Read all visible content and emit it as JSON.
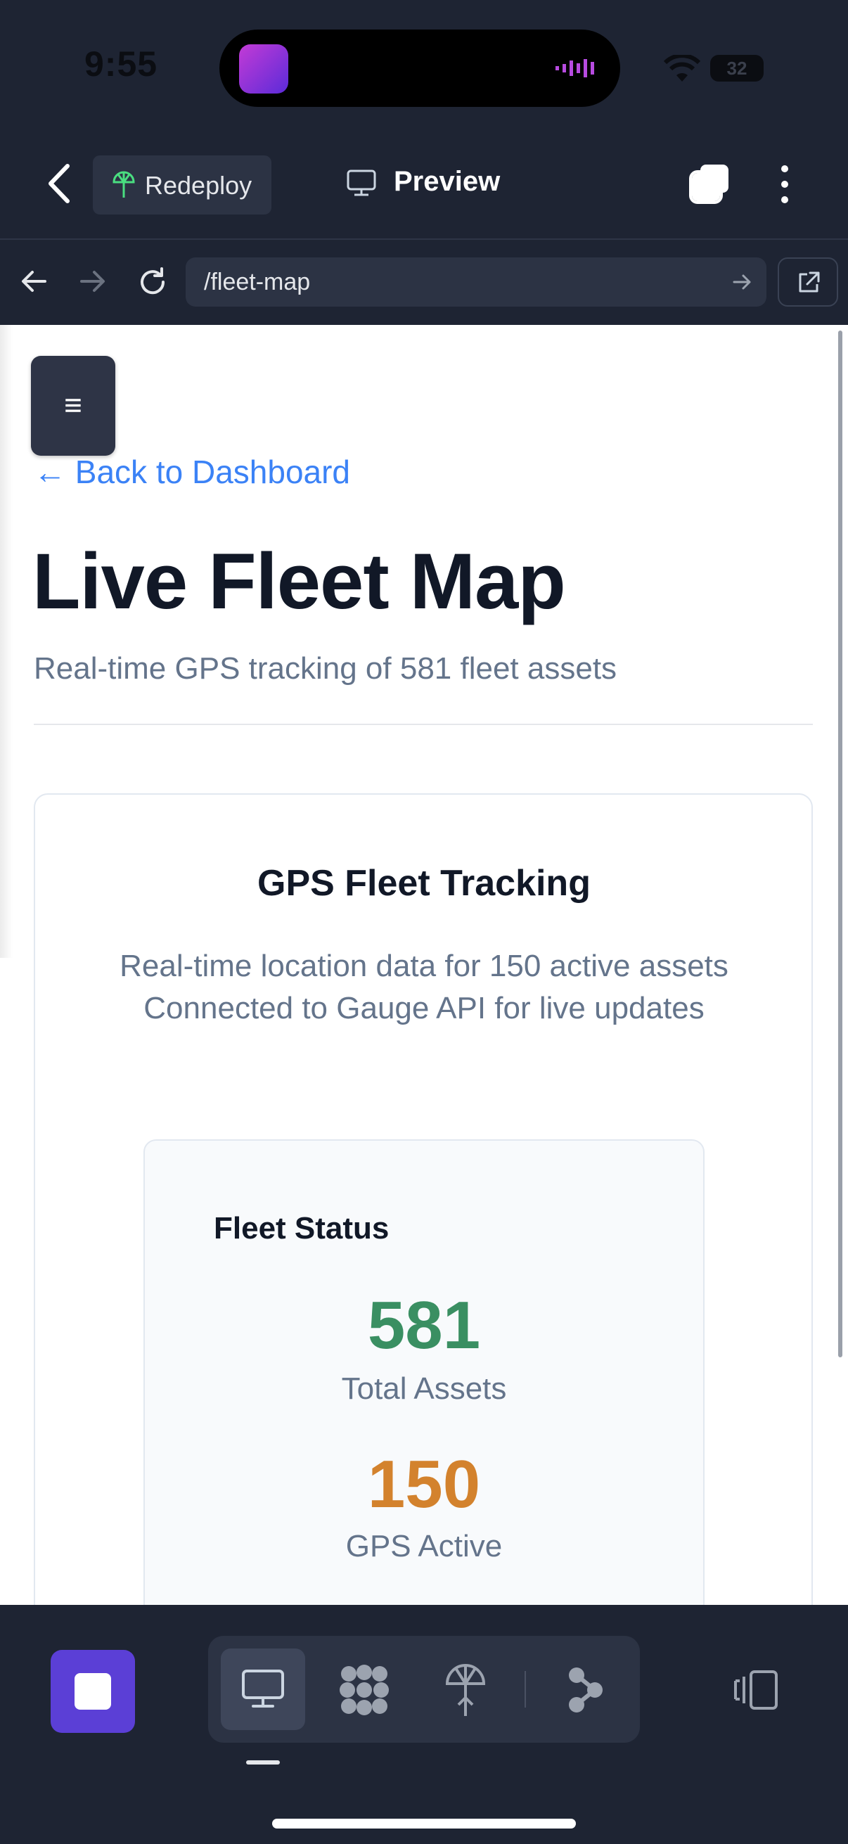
{
  "status_bar": {
    "time": "9:55",
    "battery": "32"
  },
  "header": {
    "redeploy_label": "Redeploy",
    "preview_label": "Preview"
  },
  "url_bar": {
    "path": "/fleet-map"
  },
  "page": {
    "back_link": "← Back to Dashboard",
    "title": "Live Fleet Map",
    "subtitle": "Real-time GPS tracking of 581 fleet assets",
    "menu_glyph": "≡"
  },
  "tracking_card": {
    "title": "GPS Fleet Tracking",
    "desc_line1": "Real-time location data for 150 active assets",
    "desc_line2": "Connected to Gauge API for live updates"
  },
  "fleet_status": {
    "title": "Fleet Status",
    "stats": [
      {
        "value": "581",
        "label": "Total Assets",
        "color": "#3a8f62"
      },
      {
        "value": "150",
        "label": "GPS Active",
        "color": "#d3822d"
      }
    ]
  },
  "colors": {
    "accent": "#5b3fd6",
    "link": "#3b82f6",
    "chrome_bg": "#1e2433"
  },
  "icons": [
    "back-chevron-icon",
    "redeploy-icon",
    "monitor-icon",
    "tabs-icon",
    "kebab-icon",
    "arrow-left-icon",
    "arrow-right-icon",
    "reload-icon",
    "external-link-icon",
    "stop-icon",
    "desktop-icon",
    "cluster-icon",
    "antenna-icon",
    "flow-icon",
    "device-switch-icon"
  ]
}
